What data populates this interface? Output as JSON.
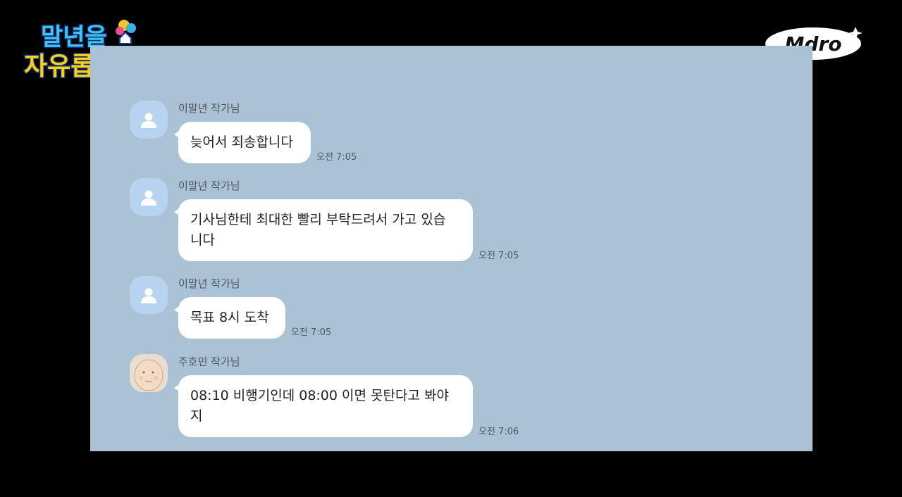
{
  "show_logo_text": "말년을 자유롭게",
  "channel_logo_text": "Mdro",
  "messages": [
    {
      "sender": "이말년 작가님",
      "avatar": "default-person-icon",
      "lines": [
        "늦어서 죄송합니다"
      ],
      "time": "오전 7:05"
    },
    {
      "sender": "이말년 작가님",
      "avatar": "default-person-icon",
      "lines": [
        "기사님한테 최대한 빨리 부탁드려서 가고 있습",
        "니다"
      ],
      "time": "오전 7:05"
    },
    {
      "sender": "이말년 작가님",
      "avatar": "default-person-icon",
      "lines": [
        "목표 8시 도착"
      ],
      "time": "오전 7:05"
    },
    {
      "sender": "주호민 작가님",
      "avatar": "drawn-face-avatar",
      "lines": [
        "08:10 비행기인데 08:00 이면 못탄다고 봐야",
        "지"
      ],
      "time": "오전 7:06"
    }
  ],
  "colors": {
    "chat_background": "#abc1d4",
    "bubble": "#ffffff",
    "default_avatar": "#b7d3ef"
  }
}
